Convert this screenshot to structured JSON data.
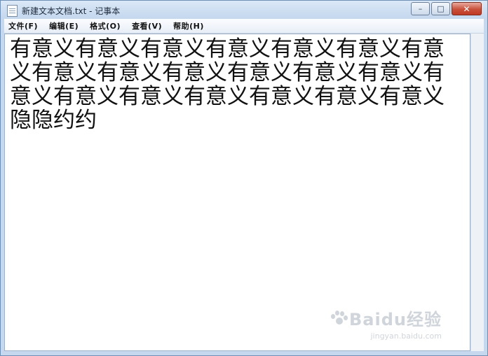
{
  "window": {
    "title": "新建文本文档.txt - 记事本",
    "controls": {
      "minimize": "–",
      "maximize": "□",
      "close": "✕"
    }
  },
  "menu": [
    "文件(F)",
    "编辑(E)",
    "格式(O)",
    "查看(V)",
    "帮助(H)"
  ],
  "document": {
    "text": "有意义有意义有意义有意义有意义有意义有意义有意义有意义有意义有意义有意义有意义有意义有意义有意义有意义有意义有意义有意义隐隐约约"
  },
  "watermark": {
    "brand": "Baidu经验",
    "url": "jingyan.baidu.com"
  },
  "colors": {
    "title_bg": "#c5d8ee",
    "close_button": "#c8503a",
    "editor_bg": "#ffffff"
  },
  "icons": [
    "notepad-icon",
    "minimize-icon",
    "maximize-icon",
    "close-icon",
    "baidu-paw-icon"
  ]
}
